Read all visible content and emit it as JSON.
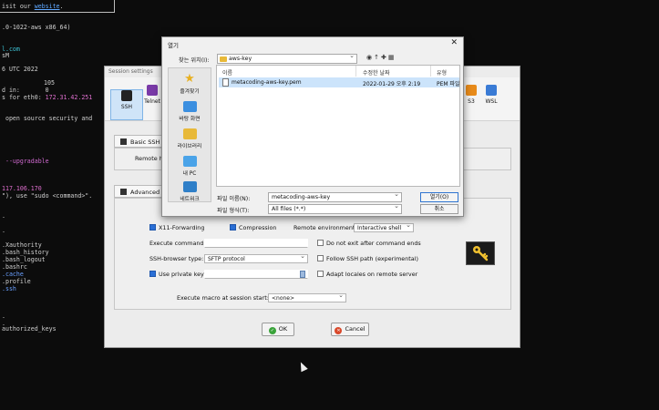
{
  "terminal": {
    "line_website_prefix": "isit our ",
    "line_website_link": "website",
    "line_website_suffix": ".",
    "kernel": ".0-1022-aws x86_64)",
    "mail": "l.com",
    "mail2": "sM",
    "date": "6 UTC 2022",
    "n105": "105",
    "logged_in": "d in:       0",
    "eth0_prefix": "s for eth0: ",
    "eth0_ip": "172.31.42.251",
    "security": " open source security and",
    "upgradable": " --upgradable",
    "ip2": "117.106.170",
    "sudo": "\"), use \"sudo <command>\".",
    "xauthority": ".Xauthority",
    "bash_history": ".bash_history",
    "bash_logout": ".bash_logout",
    "bashrc": ".bashrc",
    "cache": ".cache",
    "profile": ".profile",
    "ssh": ".ssh",
    "authorized_keys": "authorized_keys",
    "dots": "."
  },
  "session": {
    "title": "Session settings",
    "toolbar": {
      "ssh": "SSH",
      "telnet": "Telnet",
      "s3": "S3",
      "wsl": "WSL"
    },
    "tab_basic": "Basic SSH",
    "remote_host_label": "Remote h",
    "tab_advanced": "Advanced S",
    "x11_forwarding": "X11-Forwarding",
    "compression": "Compression",
    "remote_env_label": "Remote environment:",
    "remote_env_value": "Interactive shell",
    "execute_command_label": "Execute command:",
    "do_not_exit": "Do not exit after command ends",
    "browser_type_label": "SSH-browser type:",
    "browser_type_value": "SFTP protocol",
    "follow_ssh_path": "Follow SSH path (experimental)",
    "use_private_key": "Use private key",
    "adapt_locales": "Adapt locales on remote server",
    "macro_label": "Execute macro at session start:",
    "macro_value": "<none>",
    "ok": "OK",
    "cancel": "Cancel"
  },
  "dialog": {
    "title": "열기",
    "lookin_label": "찾는 위치(I):",
    "lookin_value": "aws-key",
    "places": {
      "quick": "즐겨찾기",
      "desktop": "바탕 화면",
      "library": "라이브러리",
      "pc": "내 PC",
      "network": "네트워크"
    },
    "columns": {
      "name": "이름",
      "modified": "수정한 날짜",
      "type": "유형"
    },
    "file": {
      "name": "metacoding-aws-key.pem",
      "modified": "2022-01-29 오후 2:19",
      "type": "PEM 파일"
    },
    "filename_label": "파일 이름(N):",
    "filename_value": "metacoding-aws-key",
    "filetype_label": "파일 형식(T):",
    "filetype_value": "All files (*.*)",
    "open": "열기(O)",
    "cancel": "취소"
  }
}
